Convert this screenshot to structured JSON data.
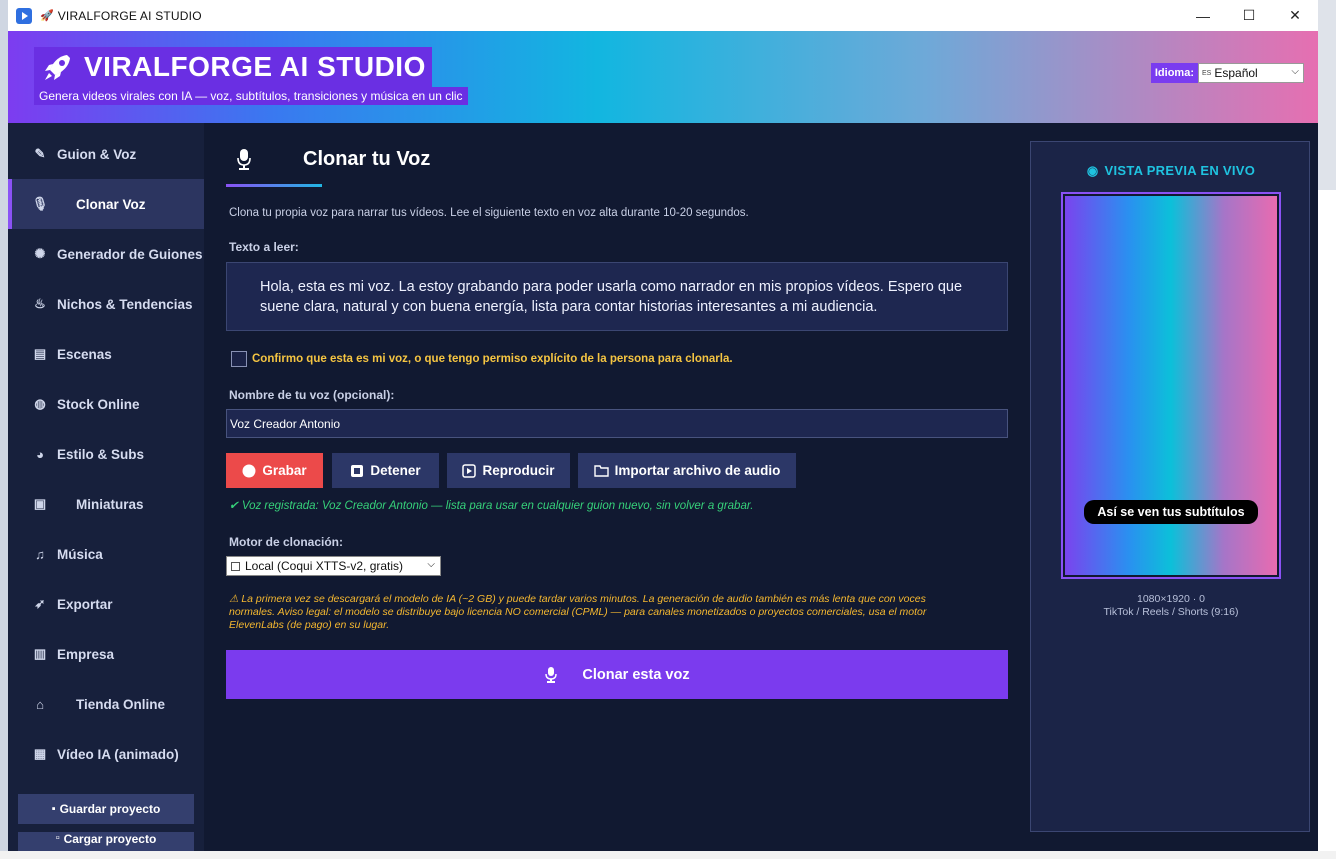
{
  "window": {
    "title": "VIRALFORGE AI STUDIO",
    "minimize": "—",
    "maximize": "☐",
    "close": "✕"
  },
  "header": {
    "brand": "VIRALFORGE AI STUDIO",
    "tagline": "Genera videos virales con IA — voz, subtítulos, transiciones y música en un clic",
    "language_label": "Idioma:",
    "language_flag": "ES",
    "language_value": "Español"
  },
  "sidebar": {
    "items": [
      {
        "label": "Guion & Voz",
        "icon": "script-icon"
      },
      {
        "label": "Clonar Voz",
        "icon": "microphone-icon"
      },
      {
        "label": "Generador de Guiones",
        "icon": "brain-icon"
      },
      {
        "label": "Nichos & Tendencias",
        "icon": "fire-icon"
      },
      {
        "label": "Escenas",
        "icon": "clapper-icon"
      },
      {
        "label": "Stock Online",
        "icon": "globe-icon"
      },
      {
        "label": "Estilo & Subs",
        "icon": "palette-icon"
      },
      {
        "label": "Miniaturas",
        "icon": "image-icon"
      },
      {
        "label": "Música",
        "icon": "music-icon"
      },
      {
        "label": "Exportar",
        "icon": "rocket-icon"
      },
      {
        "label": "Empresa",
        "icon": "building-icon"
      },
      {
        "label": "Tienda Online",
        "icon": "store-icon"
      },
      {
        "label": "Vídeo IA (animado)",
        "icon": "film-icon"
      }
    ],
    "save_label": "Guardar proyecto",
    "load_label": "Cargar proyecto"
  },
  "main": {
    "title": "Clonar tu Voz",
    "description": "Clona tu propia voz para narrar tus vídeos. Lee el siguiente texto en voz alta durante 10-20 segundos.",
    "read_label": "Texto a leer:",
    "read_text": "Hola, esta es mi voz. La estoy grabando para poder usarla como narrador en mis propios vídeos. Espero que suene clara, natural y con buena energía, lista para contar historias interesantes a mi audiencia.",
    "confirm_text": "Confirmo que esta es mi voz, o que tengo permiso explícito de la persona para clonarla.",
    "name_label": "Nombre de tu voz (opcional):",
    "name_value": "Voz Creador Antonio",
    "buttons": {
      "record": "Grabar",
      "stop": "Detener",
      "play": "Reproducir",
      "import": "Importar archivo de audio"
    },
    "status": "✔ Voz registrada: Voz Creador Antonio — lista para usar en cualquier guion nuevo, sin volver a grabar.",
    "engine_label": "Motor de clonación:",
    "engine_value": "Local (Coqui XTTS-v2, gratis)",
    "warning": "⚠ La primera vez se descargará el modelo de IA (~2 GB) y puede tardar varios minutos. La generación de audio también es más lenta que con voces normales. Aviso legal: el modelo se distribuye bajo licencia NO comercial (CPML) — para canales monetizados o proyectos comerciales, usa el motor ElevenLabs (de pago) en su lugar.",
    "clone_button": "Clonar esta voz"
  },
  "preview": {
    "title": "VISTA PREVIA EN VIVO",
    "subtitle_sample": "Así se ven tus subtítulos",
    "resolution": "1080×1920  ·  0",
    "formats": "TikTok / Reels / Shorts (9:16)"
  },
  "colors": {
    "accent": "#7b3bee",
    "record": "#ec4a4a",
    "success": "#36d17a",
    "warning": "#f5b830",
    "preview_title": "#1fc3e0"
  }
}
